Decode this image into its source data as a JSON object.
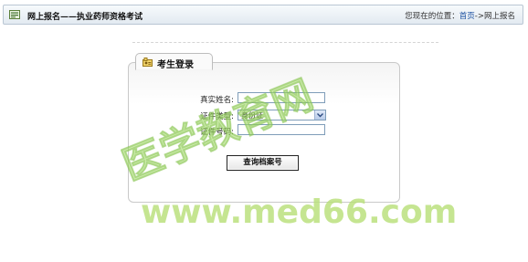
{
  "header": {
    "title": "网上报名——执业药师资格考试",
    "location_prefix": "您现在的位置：",
    "crumb_home": "首页",
    "crumb_sep": "->",
    "crumb_current": "网上报名",
    "icon": "nav-icon"
  },
  "panel": {
    "title": "考生登录",
    "icon": "login-icon"
  },
  "form": {
    "name_label": "真实姓名:",
    "name_value": "",
    "id_type_label": "证件类型:",
    "id_type_selected": "身份证",
    "id_number_label": "证件号码:",
    "id_number_value": "",
    "submit_label": "查询档案号"
  },
  "watermark": {
    "cn_text": "医学教育网",
    "url_text": "www.med66.com",
    "color": "#b9e07a"
  }
}
